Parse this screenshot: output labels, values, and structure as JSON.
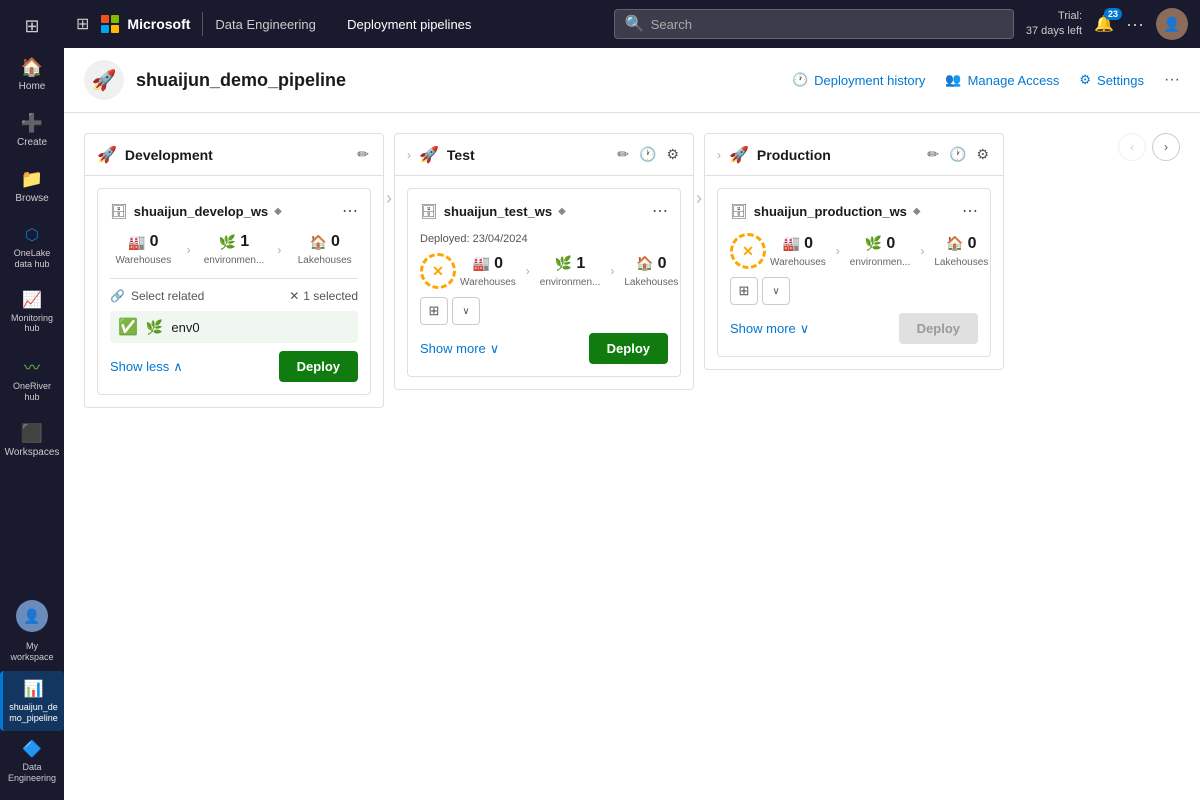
{
  "topnav": {
    "grid_icon": "⊞",
    "brand": "Microsoft",
    "section": "Data Engineering",
    "page": "Deployment pipelines",
    "search_placeholder": "Search",
    "trial_line1": "Trial:",
    "trial_line2": "37 days left",
    "notif_count": "23",
    "more_icon": "···"
  },
  "header": {
    "title": "shuaijun_demo_pipeline",
    "pipeline_icon": "🚀",
    "deployment_history": "Deployment history",
    "manage_access": "Manage Access",
    "settings": "Settings"
  },
  "stages": [
    {
      "id": "development",
      "name": "Development",
      "icon": "🚀",
      "workspace": {
        "name": "shuaijun_develop_ws",
        "diamond": "◆",
        "deployed_label": null,
        "warehouses": {
          "count": 0,
          "label": "Warehouses"
        },
        "environments": {
          "count": 1,
          "label": "environmen..."
        },
        "lakehouses": {
          "count": 0,
          "label": "Lakehouses"
        }
      },
      "select_related": {
        "label": "Select related",
        "selected_count": "1 selected",
        "items": [
          {
            "name": "env0",
            "icon": "🌿",
            "checked": true
          }
        ]
      },
      "show_toggle": "Show less",
      "deploy_label": "Deploy",
      "deploy_enabled": true,
      "has_status": false
    },
    {
      "id": "test",
      "name": "Test",
      "icon": "🚀",
      "workspace": {
        "name": "shuaijun_test_ws",
        "diamond": "◆",
        "deployed_label": "Deployed: 23/04/2024",
        "warehouses": {
          "count": 0,
          "label": "Warehouses"
        },
        "environments": {
          "count": 1,
          "label": "environmen..."
        },
        "lakehouses": {
          "count": 0,
          "label": "Lakehouses"
        }
      },
      "show_toggle": "Show more",
      "deploy_label": "Deploy",
      "deploy_enabled": true,
      "has_status": true,
      "status_symbol": "✕"
    },
    {
      "id": "production",
      "name": "Production",
      "icon": "🚀",
      "workspace": {
        "name": "shuaijun_production_ws",
        "diamond": "◆",
        "deployed_label": null,
        "warehouses": {
          "count": 0,
          "label": "Warehouses"
        },
        "environments": {
          "count": 0,
          "label": "environmen..."
        },
        "lakehouses": {
          "count": 0,
          "label": "Lakehouses"
        }
      },
      "show_toggle": "Show more",
      "deploy_label": "Deploy",
      "deploy_enabled": false,
      "has_status": true,
      "status_symbol": "✕"
    }
  ],
  "sidebar": {
    "items": [
      {
        "id": "home",
        "icon": "🏠",
        "label": "Home"
      },
      {
        "id": "create",
        "icon": "➕",
        "label": "Create"
      },
      {
        "id": "browse",
        "icon": "📁",
        "label": "Browse"
      },
      {
        "id": "onelake",
        "icon": "〰",
        "label": "OneLake\ndata hub"
      },
      {
        "id": "monitoring",
        "icon": "📊",
        "label": "Monitoring\nhub"
      },
      {
        "id": "oneriver",
        "icon": "〰",
        "label": "OneRiver\nhub"
      },
      {
        "id": "workspaces",
        "icon": "⬛",
        "label": "Workspaces"
      }
    ],
    "bottom_items": [
      {
        "id": "myworkspace",
        "icon": "👤",
        "label": "My\nworkspace"
      },
      {
        "id": "pipeline",
        "icon": "📊",
        "label": "shuaijun_de\nmo_pipeline",
        "active": true
      }
    ],
    "data_engineering_label": "Data\nEngineering"
  }
}
